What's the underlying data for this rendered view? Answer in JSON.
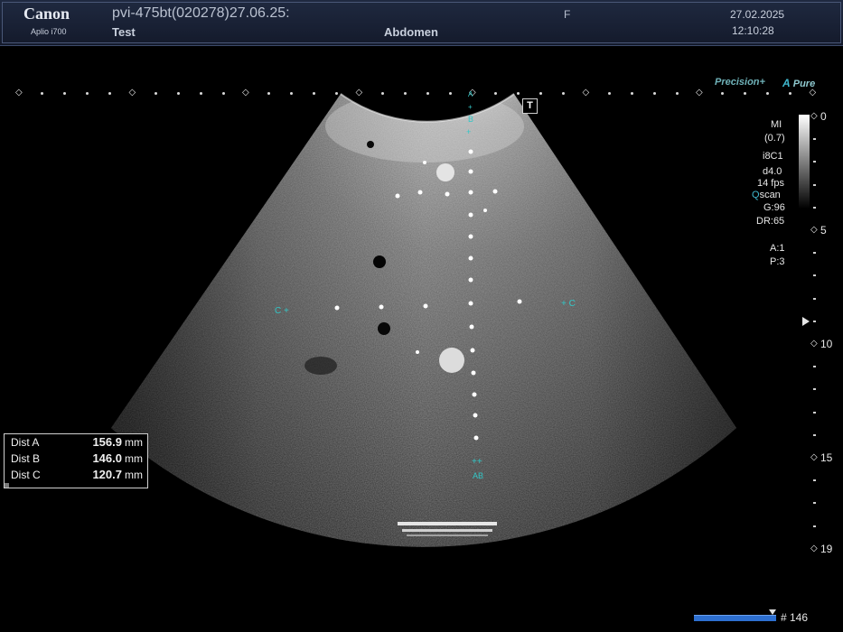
{
  "header": {
    "brand": "Canon",
    "model": "Aplio i700",
    "patient_id": "pvi-475bt(020278)27.06.25:",
    "exam_name": "Test",
    "preset": "Abdomen",
    "flag": "F",
    "date": "27.02.2025",
    "time": "12:10:28"
  },
  "image_labels": {
    "precision": "Precision+",
    "apure_a": "A",
    "apure_rest": "Pure",
    "t_marker": "T"
  },
  "params": {
    "mi_label": "MI",
    "mi_value": "(0.7)",
    "probe": "i8C1",
    "depth_focus": "d4.0",
    "fps": "14 fps",
    "qscan": "Qscan",
    "gain": "G:96",
    "dynamic_range": "DR:65",
    "a": "A:1",
    "p": "P:3"
  },
  "depth_scale": {
    "labels": [
      "0",
      "5",
      "10",
      "15",
      "19"
    ]
  },
  "measurements": [
    {
      "name": "Dist A",
      "value": "156.9",
      "unit": "mm"
    },
    {
      "name": "Dist B",
      "value": "146.0",
      "unit": "mm"
    },
    {
      "name": "Dist C",
      "value": "120.7",
      "unit": "mm"
    }
  ],
  "calipers": {
    "left_c": "C",
    "right_c": "C",
    "top_a": "A",
    "top_b": "B",
    "bottom_ab": "AB"
  },
  "cine": {
    "frame_count": "# 146",
    "progress": 0.91
  }
}
